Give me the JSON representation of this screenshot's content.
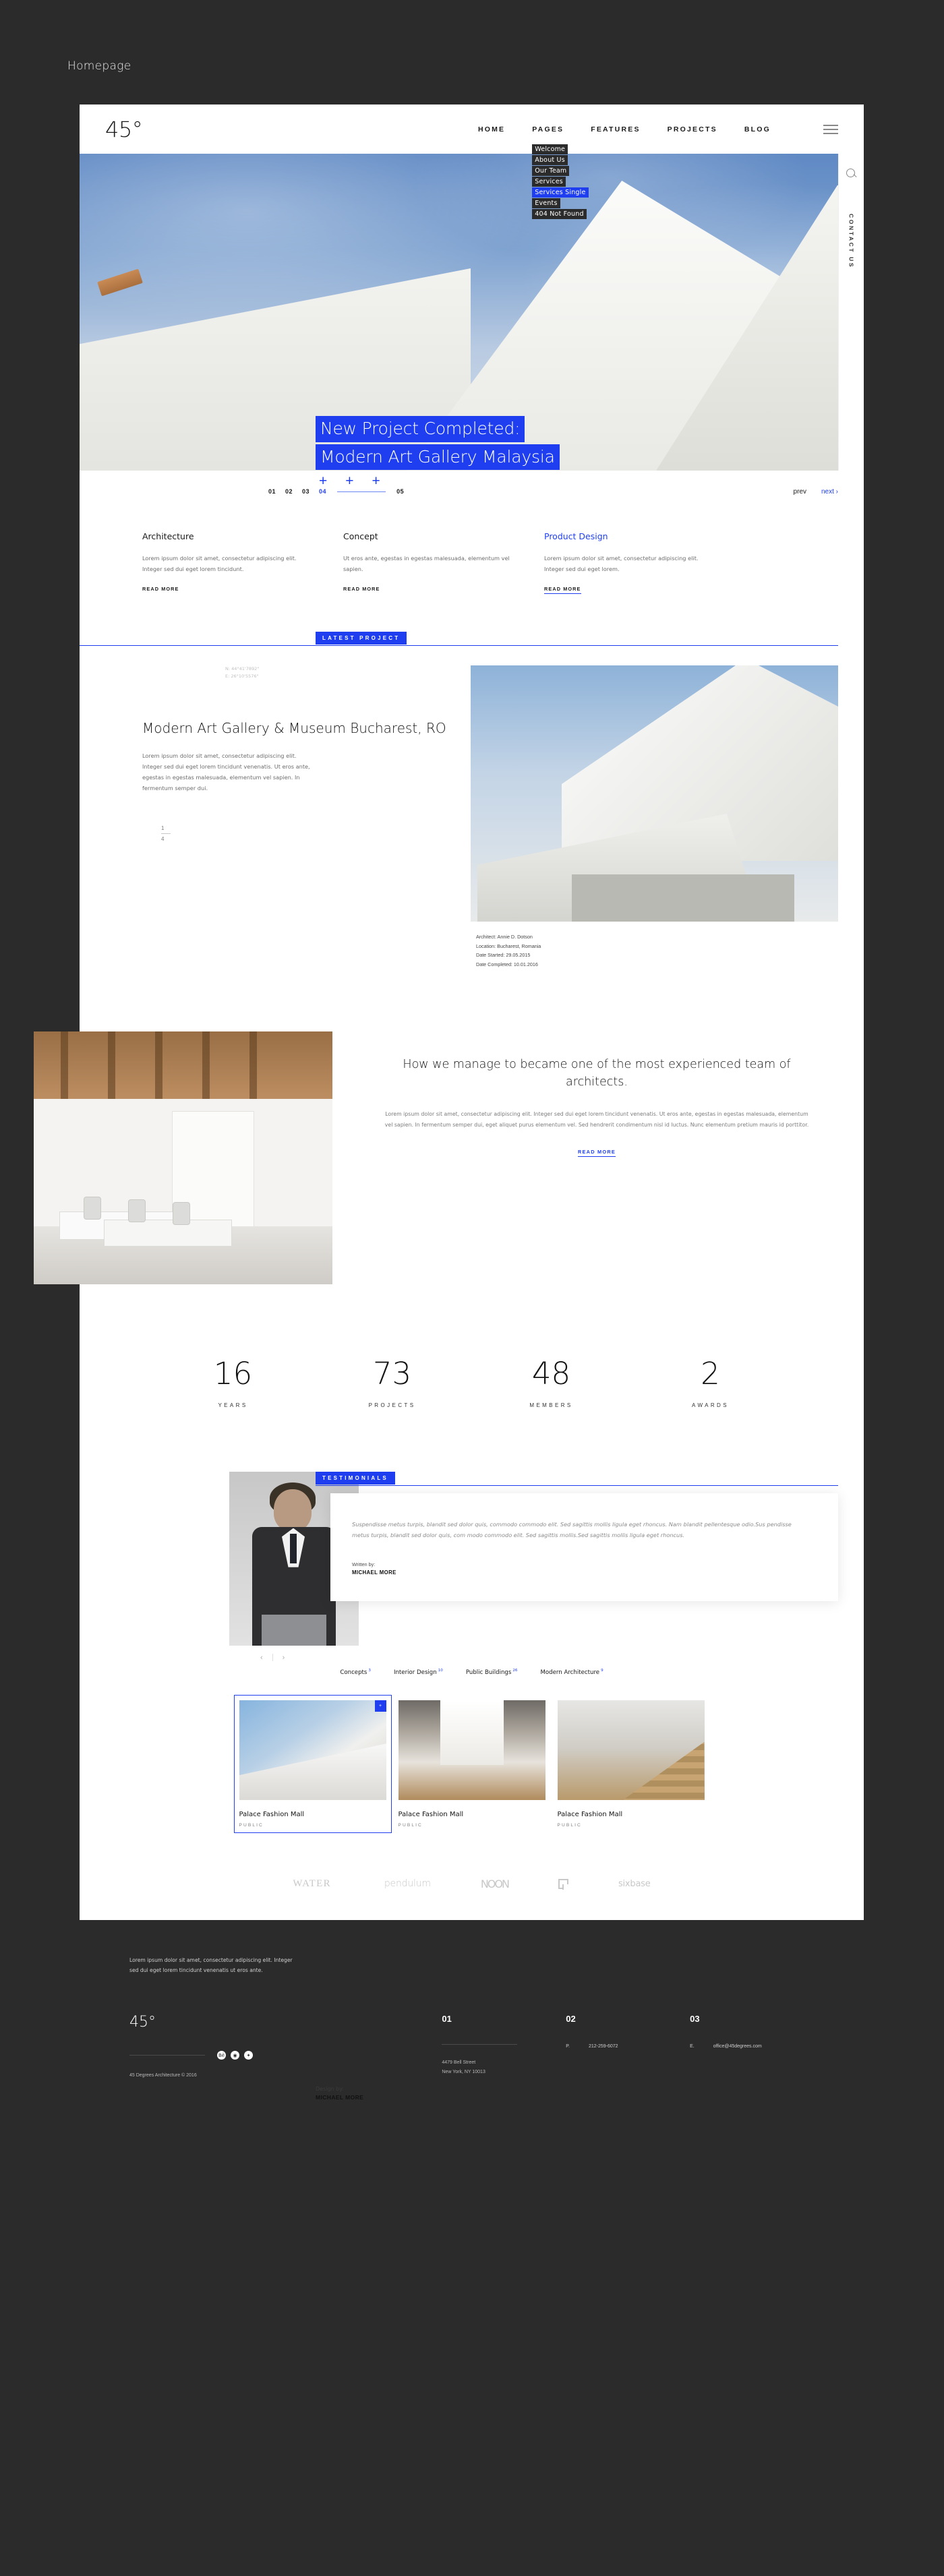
{
  "browser": {
    "label": "Homepage"
  },
  "header": {
    "logo": "45°",
    "nav": [
      {
        "label": "HOME"
      },
      {
        "label": "PAGES"
      },
      {
        "label": "FEATURES"
      },
      {
        "label": "PROJECTS"
      },
      {
        "label": "BLOG"
      }
    ],
    "dropdown": [
      {
        "label": "Welcome",
        "selected": false
      },
      {
        "label": "About Us",
        "selected": false
      },
      {
        "label": "Our Team",
        "selected": false
      },
      {
        "label": "Services",
        "selected": false
      },
      {
        "label": "Services Single",
        "selected": true
      },
      {
        "label": "Events",
        "selected": false
      },
      {
        "label": "404 Not Found",
        "selected": false
      }
    ],
    "rail": {
      "contact": "CONTACT US"
    }
  },
  "hero": {
    "title_line1": "New Project Completed:",
    "title_line2": "Modern Art Gallery Malaysia",
    "plus": [
      "+",
      "+",
      "+"
    ],
    "design_by_label": "Design by:",
    "design_by_name": "MICHAEL MORE"
  },
  "slider": {
    "numbers": [
      "01",
      "02",
      "03",
      "04",
      "05"
    ],
    "active": "04",
    "prev": "prev",
    "next": "next ›"
  },
  "services": [
    {
      "title": "Architecture",
      "text": "Lorem ipsum dolor sit amet, consectetur adipiscing elit. Integer sed dui eget lorem tincidunt.",
      "more": "READ MORE",
      "highlight": false
    },
    {
      "title": "Concept",
      "text": "Ut eros ante, egestas in egestas malesuada, elementum vel sapien.",
      "more": "READ MORE",
      "highlight": false
    },
    {
      "title": "Product Design",
      "text": "Lorem ipsum dolor sit amet, consectetur adipiscing elit. Integer sed dui eget lorem.",
      "more": "READ MORE",
      "highlight": true
    }
  ],
  "latest_project": {
    "badge": "LATEST PROJECT",
    "coord_n": "N: 44°41'7892\"",
    "coord_e": "E: 26°10'5576\"",
    "title": "Modern Art Gallery & Museum Bucharest, RO",
    "text": "Lorem ipsum dolor sit amet, consectetur adipiscing elit. Integer sed dui eget lorem tincidunt venenatis. Ut eros ante, egestas in egestas malesuada, elementum vel sapien. In fermentum semper dui.",
    "counter_current": "1",
    "counter_total": "4",
    "meta": [
      "Architect: Annie D. Dotson",
      "Location: Bucharest, Romania",
      "Date Started: 29.05.2015",
      "Date Completed: 10.01.2016"
    ]
  },
  "manage": {
    "heading": "How we manage to became one of the most experienced team of architects.",
    "text": "Lorem ipsum dolor sit amet, consectetur adipiscing elit. Integer sed dui eget lorem tincidunt venenatis. Ut eros ante, egestas in egestas malesuada, elementum vel sapien. In fermentum semper dui, eget aliquet purus elementum vel. Sed hendrerit condimentum nisl id luctus. Nunc elementum pretium mauris id porttitor.",
    "more": "READ MORE"
  },
  "stats": [
    {
      "number": "16",
      "label": "YEARS"
    },
    {
      "number": "73",
      "label": "PROJECTS"
    },
    {
      "number": "48",
      "label": "MEMBERS"
    },
    {
      "number": "2",
      "label": "AWARDS"
    }
  ],
  "testimonials": {
    "badge": "TESTIMONIALS",
    "quote": "Suspendisse metus turpis, blandit sed dolor quis, commodo commodo elit. Sed sagittis mollis ligula eget rhoncus. Nam blandit pellentesque odio.Sus pendisse metus turpis, blandit sed dolor quis, com modo commodo elit. Sed sagittis mollis.Sed sagittis mollis ligula eget rhoncus.",
    "written_by_label": "Written by:",
    "written_by_name": "MICHAEL MORE",
    "prev_arrow": "‹",
    "next_arrow": "›"
  },
  "portfolio": {
    "filters": [
      {
        "label": "Concepts",
        "count": "3"
      },
      {
        "label": "Interior Design",
        "count": "10"
      },
      {
        "label": "Public Buildings",
        "count": "26"
      },
      {
        "label": "Modern Architecture",
        "count": "9"
      }
    ],
    "cards": [
      {
        "title": "Palace Fashion Mall",
        "category": "PUBLIC",
        "badge": "+",
        "selected": true
      },
      {
        "title": "Palace Fashion Mall",
        "category": "PUBLIC",
        "badge": "",
        "selected": false
      },
      {
        "title": "Palace Fashion Mall",
        "category": "PUBLIC",
        "badge": "",
        "selected": false
      }
    ]
  },
  "logos": [
    {
      "name": "WATER"
    },
    {
      "name": "pendulum"
    },
    {
      "name": "NOON"
    },
    {
      "name": ""
    },
    {
      "name": "sixbase"
    }
  ],
  "footer": {
    "intro": "Lorem ipsum dolor sit amet, consectetur adipiscing elit. Integer sed dui eget lorem tincidunt venenatis ut eros ante.",
    "logo": "45°",
    "social": [
      "Bē",
      "◉",
      "✦"
    ],
    "copyright": "45 Degrees Architecture © 2016",
    "col_01": {
      "number": "01",
      "address_line1": "4479 Bell Street",
      "address_line2": "New York, NY 10013"
    },
    "col_02": {
      "number": "02",
      "key": "P.",
      "value": "212-259-6072"
    },
    "col_03": {
      "number": "03",
      "key": "E.",
      "value": "office@45degrees.com"
    }
  },
  "colors": {
    "accent": "#1e3ef0",
    "dark": "#2b2b2b",
    "text": "#1a1a1a"
  }
}
